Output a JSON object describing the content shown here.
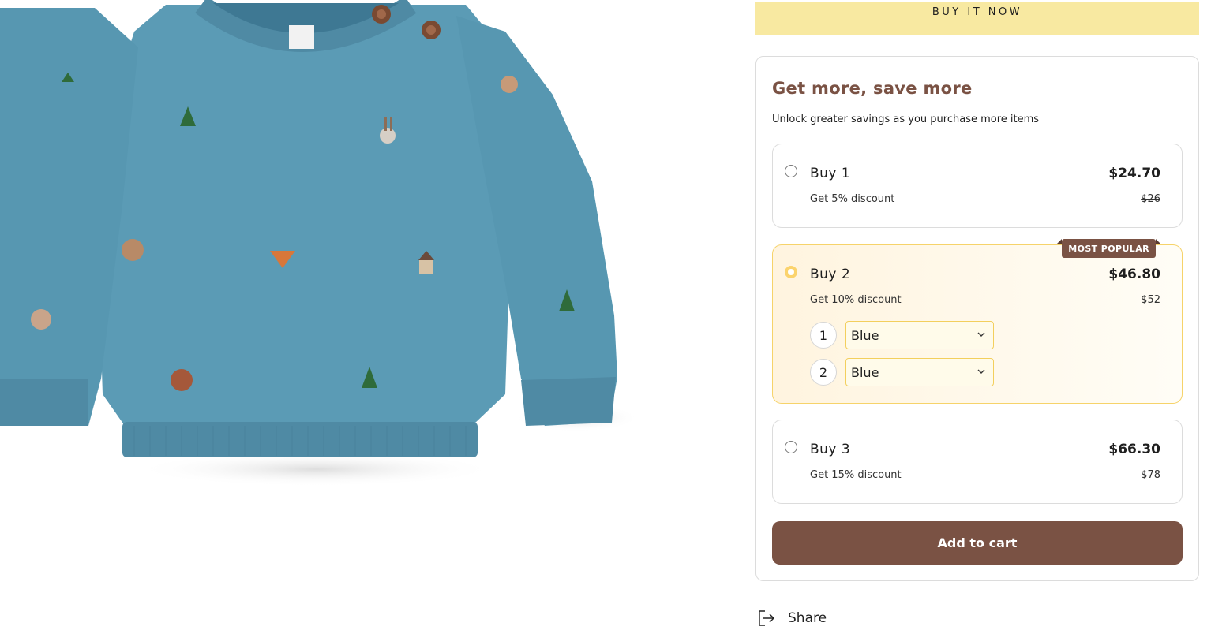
{
  "buy_now_label": "BUY IT NOW",
  "bundle": {
    "title": "Get more, save more",
    "subtitle": "Unlock greater savings as you purchase more items",
    "offers": [
      {
        "name": "Buy 1",
        "discount": "Get 5% discount",
        "price": "$24.70",
        "compare_price": "$26",
        "selected": false
      },
      {
        "name": "Buy 2",
        "discount": "Get 10% discount",
        "price": "$46.80",
        "compare_price": "$52",
        "selected": true,
        "badge": "MOST POPULAR",
        "variants": [
          {
            "index": "1",
            "value": "Blue"
          },
          {
            "index": "2",
            "value": "Blue"
          }
        ]
      },
      {
        "name": "Buy 3",
        "discount": "Get 15% discount",
        "price": "$66.30",
        "compare_price": "$78",
        "selected": false
      }
    ]
  },
  "add_to_cart_label": "Add to cart",
  "share_label": "Share",
  "colors": {
    "accent_brown": "#7a5244",
    "buy_now_bg": "#f8e9a1",
    "selected_border": "#f6d36a",
    "sweater_blue": "#5b9bb5"
  },
  "icons": {
    "share": "share-icon",
    "chevron": "chevron-down-icon"
  }
}
